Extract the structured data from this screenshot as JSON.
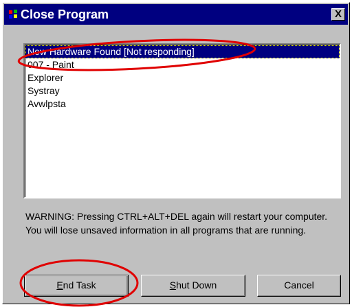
{
  "window": {
    "title": "Close Program",
    "close_label": "X"
  },
  "process_list": {
    "items": [
      {
        "label": "New Hardware Found [Not responding]",
        "selected": true
      },
      {
        "label": "007 - Paint",
        "selected": false
      },
      {
        "label": "Explorer",
        "selected": false
      },
      {
        "label": "Systray",
        "selected": false
      },
      {
        "label": "Avwlpsta",
        "selected": false
      }
    ]
  },
  "warning_text": "WARNING: Pressing CTRL+ALT+DEL again will restart your computer. You will lose unsaved information in all programs that are running.",
  "buttons": {
    "end_task_accel": "E",
    "end_task_rest": "nd Task",
    "shut_down_accel": "S",
    "shut_down_rest": "hut Down",
    "cancel": "Cancel"
  },
  "colors": {
    "titlebar": "#000080",
    "face": "#c0c0c0",
    "selection": "#000080",
    "annotation": "#e00000"
  }
}
